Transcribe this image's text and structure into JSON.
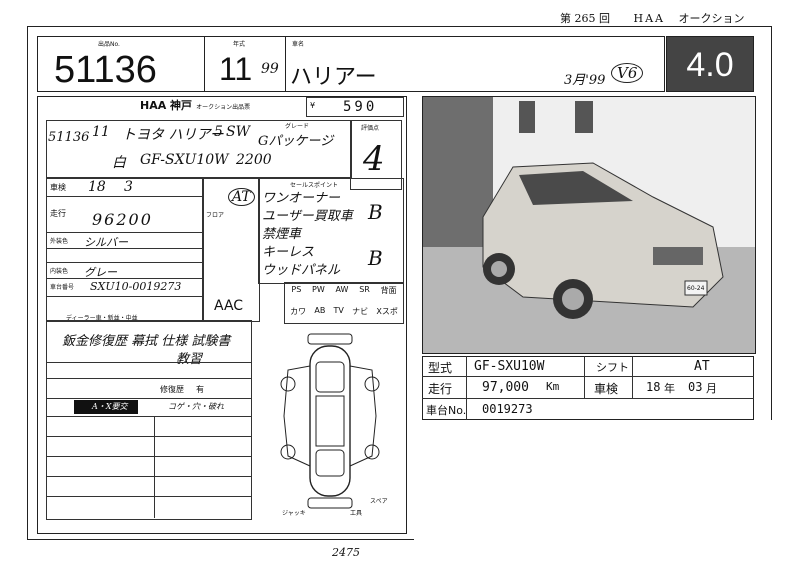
{
  "header": {
    "edition_prefix": "第",
    "edition_number": "265",
    "edition_suffix": "回",
    "house": "HAA",
    "auction": "オークション"
  },
  "top": {
    "lot_label": "出品No.",
    "lot_number": "51136",
    "year_label": "年式",
    "year_value": "11",
    "year_note": "99",
    "name_label": "車名",
    "name_value": "ハリアー",
    "side_note": "3月'99",
    "side_note2": "V6",
    "grade": "4.0"
  },
  "sheet": {
    "brand": "HAA 神戸",
    "brand_sub": "オークション出品票",
    "price_prefix": "¥",
    "price": "590",
    "lot_number": "51136",
    "model_year": "11",
    "maker_model": "トヨタ ハリアー",
    "doors": "5",
    "body_type": "SW",
    "grade_label": "グレード",
    "grade_name": "Gパッケージ",
    "color": "白",
    "chassis_code": "GF-SXU10W",
    "displacement": "2200",
    "score_label": "評価点",
    "score": "4",
    "shaken_label": "車検",
    "shaken_year": "18",
    "shaken_month": "3",
    "mileage_label": "走行",
    "mileage": "96200",
    "ext_color_label": "外装色",
    "ext_color": "シルバー",
    "int_color_label": "内装色",
    "int_color": "グレー",
    "frame_label": "車台番号",
    "frame_no": "SXU10-0019273",
    "trans_label": "フロア",
    "trans": "AT",
    "ac": "AAC",
    "sales_point_label": "セールスポイント",
    "sales_points": [
      "ワンオーナー",
      "ユーザー買取車",
      "禁煙車",
      "キーレス",
      "ウッドパネル"
    ],
    "scores_right": [
      "B",
      "B"
    ],
    "options_row1": [
      "PS",
      "PW",
      "AW",
      "SR",
      "背面"
    ],
    "options_row2": [
      "カワ",
      "AB",
      "TV",
      "ナビ",
      "Xスポ"
    ],
    "dealer_label": "ディーラー車・新並・中並",
    "notes": [
      "鈑金修復歴 幕拭 仕様 試験書",
      "教習"
    ],
    "repair_label": "修復歴",
    "repair_value": "有",
    "inspect_label": "A・X要交",
    "inspect_note": "コゲ・穴・破れ",
    "footer_left": "ジャッキ",
    "footer_right": "工具",
    "spare": "スペア",
    "page_no": "2475"
  },
  "summary": {
    "type_label": "型式",
    "type_value": "GF-SXU10W",
    "shift_label": "シフト",
    "shift_value": "AT",
    "mileage_label": "走行",
    "mileage_value": "97,000",
    "mileage_unit": "Km",
    "shaken_label": "車検",
    "shaken_year": "18",
    "shaken_year_unit": "年",
    "shaken_month": "03",
    "shaken_month_unit": "月",
    "frame_label": "車台No.",
    "frame_value": "0019273"
  },
  "photo": {
    "plate": "60-24"
  }
}
